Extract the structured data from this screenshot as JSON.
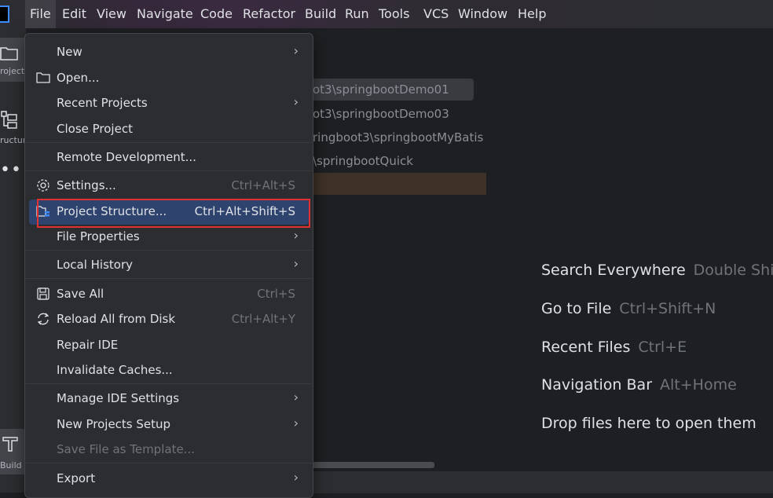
{
  "menubar": {
    "items": [
      "File",
      "Edit",
      "View",
      "Navigate",
      "Code",
      "Refactor",
      "Build",
      "Run",
      "Tools",
      "VCS",
      "Window",
      "Help"
    ]
  },
  "toolstrip": {
    "project_label": "roject",
    "structure_label": "ructur",
    "build_label": "Build"
  },
  "project_panel": {
    "rows": [
      "ot3\\springbootDemo01",
      "ot3\\springbootDemo03",
      "ringboot3\\springbootMyBatis",
      "\\springbootQuick"
    ]
  },
  "file_menu": {
    "new": "New",
    "open": "Open...",
    "recent_projects": "Recent Projects",
    "close_project": "Close Project",
    "remote_development": "Remote Development...",
    "settings": "Settings...",
    "settings_shortcut": "Ctrl+Alt+S",
    "project_structure": "Project Structure...",
    "project_structure_shortcut": "Ctrl+Alt+Shift+S",
    "file_properties": "File Properties",
    "local_history": "Local History",
    "save_all": "Save All",
    "save_all_shortcut": "Ctrl+S",
    "reload_all": "Reload All from Disk",
    "reload_all_shortcut": "Ctrl+Alt+Y",
    "repair_ide": "Repair IDE",
    "invalidate_caches": "Invalidate Caches...",
    "manage_ide_settings": "Manage IDE Settings",
    "new_projects_setup": "New Projects Setup",
    "save_file_as_template": "Save File as Template...",
    "export": "Export"
  },
  "hints": [
    {
      "label": "Search Everywhere",
      "shortcut": "Double Shi"
    },
    {
      "label": "Go to File",
      "shortcut": "Ctrl+Shift+N"
    },
    {
      "label": "Recent Files",
      "shortcut": "Ctrl+E"
    },
    {
      "label": "Navigation Bar",
      "shortcut": "Alt+Home"
    },
    {
      "label": "Drop files here to open them",
      "shortcut": ""
    }
  ],
  "colors": {
    "highlight": "#2e436e",
    "annotation_box": "#e03232",
    "accent": "#3d8bff"
  }
}
